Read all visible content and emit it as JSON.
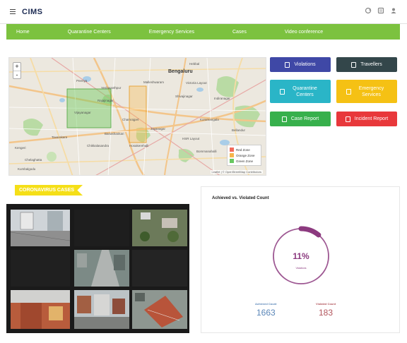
{
  "header": {
    "brand": "CIMS",
    "icons": [
      "menu-icon",
      "refresh-icon",
      "notification-icon",
      "user-icon"
    ]
  },
  "nav": {
    "items": [
      {
        "label": "Home"
      },
      {
        "label": "Quarantine Centers"
      },
      {
        "label": "Emergency Services"
      },
      {
        "label": "Cases"
      },
      {
        "label": "Video conference"
      }
    ]
  },
  "map": {
    "city": "Bengaluru",
    "places": [
      "Peenya",
      "Yeshwanthpur",
      "Hebbal",
      "Malleshwaram",
      "Rajajinagar",
      "Vijayanagar",
      "Chamrajpet",
      "Shivajinagar",
      "Indiranagar",
      "Victoria Layout",
      "Jayanagar",
      "Banashankari",
      "Chikkalasandra",
      "Kengeri",
      "Chelaghatta",
      "Bommanahalli",
      "HSR Layout",
      "Koramangala",
      "Tavarekere",
      "Kumbalgodu",
      "Hosakerehalli",
      "Bellandur"
    ],
    "zoom_in": "+",
    "zoom_out": "-",
    "legend": [
      {
        "label": "Red Zone",
        "color": "#f26b5b"
      },
      {
        "label": "Orange Zone",
        "color": "#f6b54c"
      },
      {
        "label": "Green Zone",
        "color": "#68c860"
      }
    ],
    "attribution": "Leaflet | © OpenStreetMap Contributors"
  },
  "buttons": [
    {
      "label": "Violations",
      "color": "#3f48a6",
      "icon": "phone-icon"
    },
    {
      "label": "Travellers",
      "color": "#33464a",
      "icon": "passport-icon"
    },
    {
      "label": "Quarantine Centers",
      "color": "#2ab5c7",
      "icon": "building-icon"
    },
    {
      "label": "Emergency Services",
      "color": "#f5c114",
      "icon": "ambulance-icon"
    },
    {
      "label": "Case Report",
      "color": "#37b04c",
      "icon": "report-icon"
    },
    {
      "label": "Incident Report",
      "color": "#e8383b",
      "icon": "alert-icon"
    }
  ],
  "cases": {
    "heading": "CORONAVIRUS CASES"
  },
  "stats": {
    "title": "Achieved vs. Violated Count",
    "percent_label": "11%",
    "percent_value": 11,
    "percent_caption": "Violations",
    "achieved_label": "Achieved Count",
    "achieved_value": "1663",
    "violated_label": "Violated Count",
    "violated_value": "183",
    "colors": {
      "gauge": "#8c3a7f",
      "achieved": "#5a86b8",
      "violated": "#b2555c"
    }
  }
}
